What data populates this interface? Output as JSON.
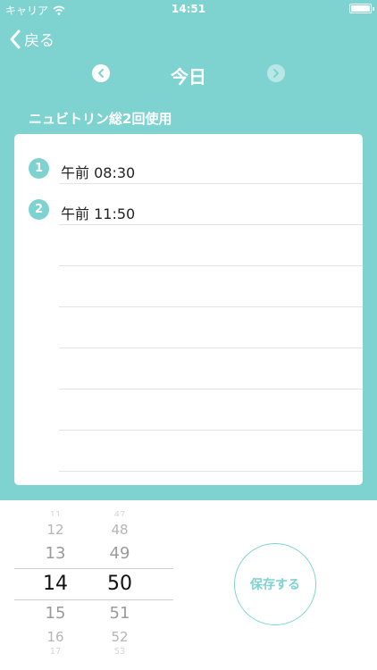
{
  "status_bar": {
    "carrier": "キャリア",
    "time": "14:51"
  },
  "nav": {
    "back_label": "戻る"
  },
  "day_nav": {
    "title": "今日"
  },
  "usage_label": "ニュビトリン総2回使用",
  "entries": [
    {
      "index": "1",
      "time": "午前 08:30"
    },
    {
      "index": "2",
      "time": "午前 11:50"
    }
  ],
  "picker": {
    "hours": [
      "11",
      "12",
      "13",
      "14",
      "15",
      "16",
      "17"
    ],
    "minutes": [
      "47",
      "48",
      "49",
      "50",
      "51",
      "52",
      "53"
    ],
    "selected_hour": "14",
    "selected_minute": "50"
  },
  "save_label": "保存する",
  "colors": {
    "accent": "#7ed3d1",
    "text": "#222222"
  }
}
